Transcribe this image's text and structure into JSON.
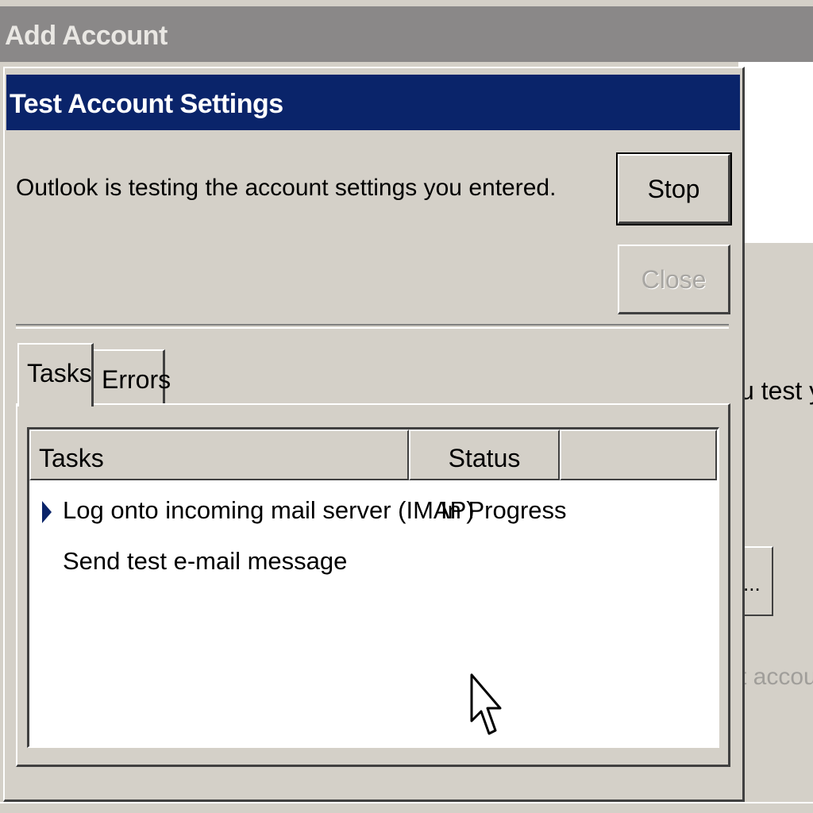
{
  "background_window": {
    "title": "Add Account",
    "partial_text_1": "u test yo",
    "partial_button_label": "...",
    "partial_text_2": "t accoun"
  },
  "dialog": {
    "title": "Test Account Settings",
    "message": "Outlook is testing the account settings you entered.",
    "buttons": {
      "stop": "Stop",
      "close": "Close"
    },
    "tabs": [
      {
        "label": "Tasks",
        "selected": true
      },
      {
        "label": "Errors",
        "selected": false
      }
    ],
    "table": {
      "columns": [
        "Tasks",
        "Status",
        ""
      ],
      "rows": [
        {
          "task": "Log onto incoming mail server (IMAP)",
          "status": "In Progress",
          "current": true
        },
        {
          "task": "Send test e-mail message",
          "status": "",
          "current": false
        }
      ]
    }
  },
  "colors": {
    "titlebar_active": "#0a246a",
    "titlebar_inactive": "#8a8888",
    "face": "#d4d0c8"
  },
  "icons": {
    "current_task": "triangle-right-icon",
    "pointer": "mouse-cursor-icon"
  }
}
